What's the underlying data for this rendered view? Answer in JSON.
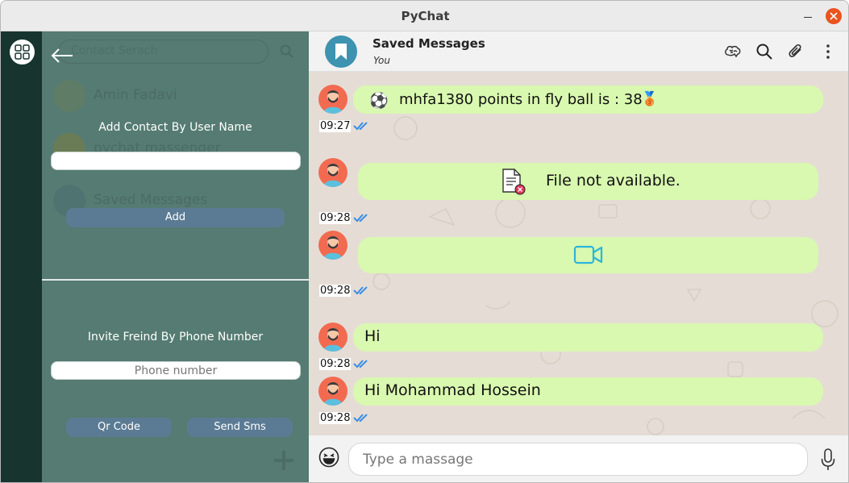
{
  "window": {
    "title": "PyChat"
  },
  "panel": {
    "background_search_placeholder": "Contact Serach",
    "background_contacts": [
      {
        "name": "Amin Fadavi"
      },
      {
        "name": "pychat massenger"
      },
      {
        "name": "Saved Messages"
      }
    ],
    "add_contact": {
      "title": "Add Contact By User Name",
      "username_value": "",
      "add_label": "Add"
    },
    "invite": {
      "title": "Invite Freind By Phone Number",
      "phone_placeholder": "Phone number",
      "qr_label": "Qr Code",
      "sms_label": "Send Sms"
    }
  },
  "chat": {
    "name": "Saved Messages",
    "subtitle": "You",
    "messages": [
      {
        "type": "text",
        "prefix_emoji": "⚽",
        "text": "mhfa1380 points in fly ball is : 38",
        "suffix_emoji": "🥉",
        "time": "09:27"
      },
      {
        "type": "file",
        "text": "File not available.",
        "time": "09:28"
      },
      {
        "type": "video",
        "time": "09:28"
      },
      {
        "type": "text",
        "text": "Hi",
        "time": "09:28"
      },
      {
        "type": "text",
        "text": "Hi Mohammad Hossein",
        "time": "09:28"
      }
    ],
    "input_placeholder": "Type a massage"
  },
  "colors": {
    "rail": "#17352e",
    "panel": "#557b72",
    "bubble": "#d9f8b0",
    "chat_bg": "#e5ddd5",
    "button": "#5b7b94",
    "avatar": "#f26b51",
    "header_avatar": "#3d93b0",
    "tick": "#3a8ee6",
    "close_button": "#e9541f"
  },
  "icons": {
    "window": [
      "minimize-icon",
      "close-icon"
    ],
    "rail": [
      "apps-grid-icon"
    ],
    "panel": [
      "back-arrow-icon",
      "search-icon",
      "plus-icon"
    ],
    "header": [
      "bookmark-icon",
      "brain-icon",
      "search-icon",
      "paperclip-icon",
      "more-vertical-icon"
    ],
    "messages": [
      "file-error-icon",
      "video-icon",
      "double-check-icon"
    ],
    "input": [
      "emoji-icon",
      "microphone-icon"
    ]
  }
}
